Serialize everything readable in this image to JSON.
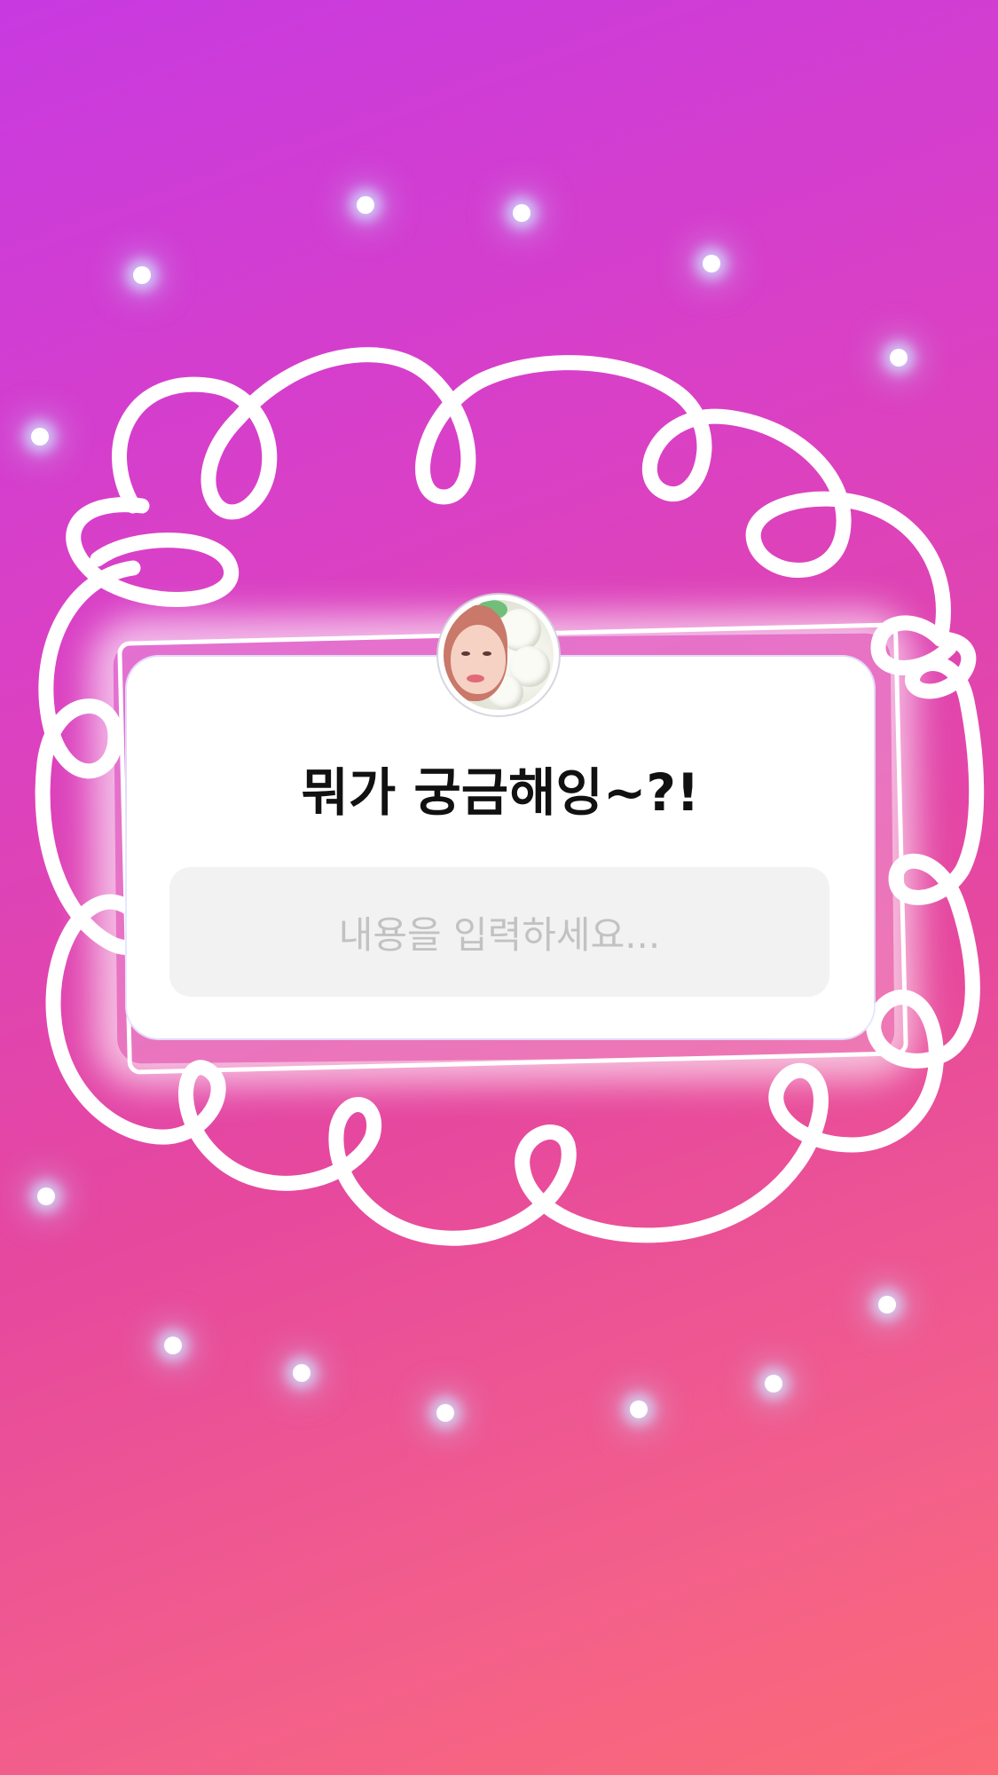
{
  "story": {
    "background_colors": [
      "#c83ae0",
      "#e6489e",
      "#fb6a75"
    ],
    "question_sticker": {
      "avatar_icon": "profile-photo",
      "question": "뭐가 궁금해잉~?!",
      "input_placeholder": "내용을 입력하세요..."
    },
    "decoration": {
      "doodle_color": "#ffffff",
      "sparkle_color": "#ffffff"
    }
  }
}
